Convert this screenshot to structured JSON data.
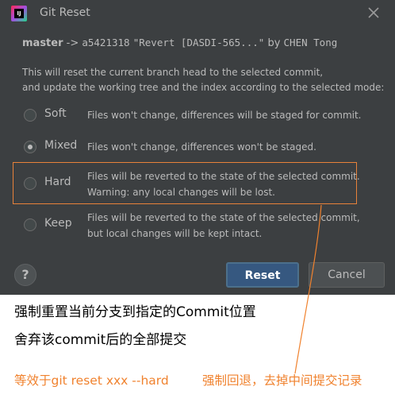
{
  "window": {
    "title": "Git Reset",
    "logo_text": "IJ",
    "close_icon": "close-icon"
  },
  "commit": {
    "branch": "master",
    "arrow": " -> ",
    "hash": "a5421318",
    "message": "\"Revert [DASDI-565...\"",
    "by": "by",
    "author": "CHEN Tong"
  },
  "description": {
    "line1": "This will reset the current branch head to the selected commit,",
    "line2": "and update the working tree and the index according to the selected mode:"
  },
  "modes": [
    {
      "label": "Soft",
      "line1": "Files won't change, differences will be staged for commit.",
      "line2": "",
      "checked": false
    },
    {
      "label": "Mixed",
      "line1": "Files won't change, differences won't be staged.",
      "line2": "",
      "checked": true
    },
    {
      "label": "Hard",
      "line1": "Files will be reverted to the state of the selected commit.",
      "line2": "Warning: any local changes will be lost.",
      "checked": false
    },
    {
      "label": "Keep",
      "line1": "Files will be reverted to the state of the selected commit,",
      "line2": "but local changes will be kept intact.",
      "checked": false
    }
  ],
  "buttons": {
    "help": "?",
    "reset": "Reset",
    "cancel": "Cancel"
  },
  "annotations": {
    "line1": "强制重置当前分支到指定的Commit位置",
    "line2": "舍弃该commit后的全部提交",
    "line3": "等效于git reset xxx --hard",
    "line4": "强制回退，去掉中间提交记录",
    "highlight_color": "#e8823a"
  }
}
